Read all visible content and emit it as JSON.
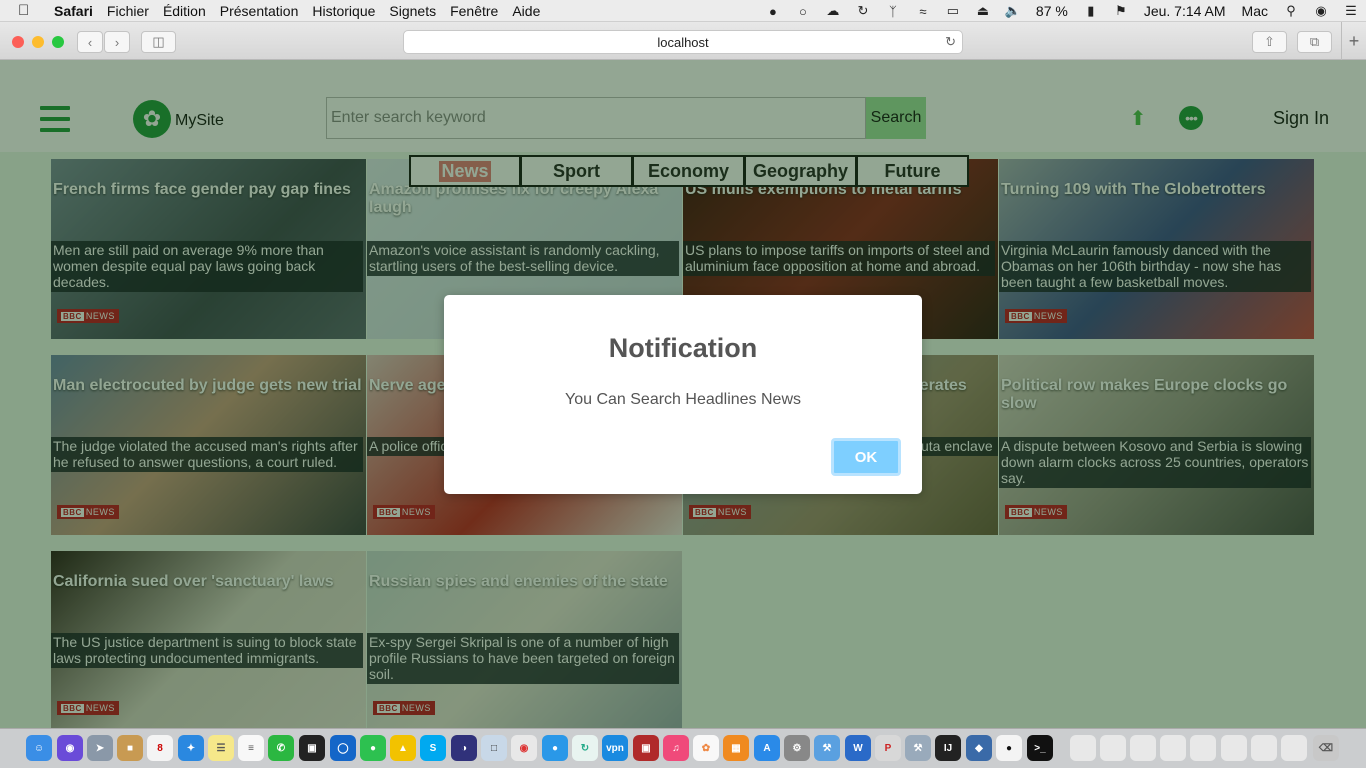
{
  "menubar": {
    "app_name": "Safari",
    "items": [
      "Fichier",
      "Édition",
      "Présentation",
      "Historique",
      "Signets",
      "Fenêtre",
      "Aide"
    ],
    "battery": "87 %",
    "clock": "Jeu. 7:14 AM",
    "user": "Mac"
  },
  "browser": {
    "url": "localhost"
  },
  "site": {
    "logo_text": "MySite",
    "search_placeholder": "Enter search keyword",
    "search_button": "Search",
    "sign_in": "Sign In",
    "colors": {
      "brand": "#1e9a3c",
      "search_button": "#9fe2a0",
      "active_tab": "#e67a7a"
    },
    "tabs": [
      "News",
      "Sport",
      "Economy",
      "Geography",
      "Future"
    ],
    "active_tab": "News",
    "badge_text": "NEWS",
    "badge_brand": "BBC",
    "cards": [
      {
        "title": "French firms face gender pay gap fines",
        "desc": "Men are still paid on average 9% more than women despite equal pay laws going back decades."
      },
      {
        "title": "Amazon promises fix for creepy Alexa laugh",
        "desc": "Amazon's voice assistant is randomly cackling, startling users of the best-selling device."
      },
      {
        "title": "US mulls exemptions to metal tariffs",
        "desc": "US plans to impose tariffs on imports of steel and aluminium face opposition at home and abroad."
      },
      {
        "title": "Turning 109 with The Globetrotters",
        "desc": "Virginia McLaurin famously danced with the Obamas on her 106th birthday - now she has been taught a few basketball moves."
      },
      {
        "title": "Man electrocuted by judge gets new trial",
        "desc": "The judge violated the accused man's rights after he refused to answer questions, a court ruled."
      },
      {
        "title": "Nerve agent",
        "desc": "A police officer and his daughter"
      },
      {
        "title": "liberates",
        "desc": "uta enclave"
      },
      {
        "title": "Political row makes Europe clocks go slow",
        "desc": "A dispute between Kosovo and Serbia is slowing down alarm clocks across 25 countries, operators say."
      },
      {
        "title": "California sued over 'sanctuary' laws",
        "desc": "The US justice department is suing to block state laws protecting undocumented immigrants."
      },
      {
        "title": "Russian spies and enemies of the state",
        "desc": "Ex-spy Sergei Skripal is one of a number of high profile Russians to have been targeted on foreign soil."
      }
    ]
  },
  "modal": {
    "title": "Notification",
    "message": "You Can Search Headlines News",
    "ok_label": "OK"
  }
}
